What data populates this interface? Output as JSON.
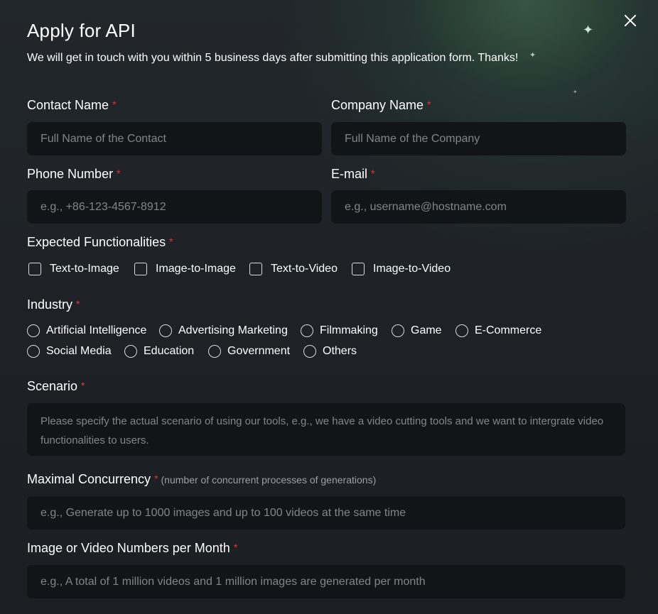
{
  "dialog": {
    "title": "Apply for API",
    "subtitle": "We will get in touch with you within 5 business days after submitting this application form. Thanks!",
    "close_icon": "close-icon"
  },
  "required_mark": "*",
  "fields": {
    "contact_name": {
      "label": "Contact Name",
      "placeholder": "Full Name of the Contact",
      "value": ""
    },
    "company_name": {
      "label": "Company Name",
      "placeholder": "Full Name of the Company",
      "value": ""
    },
    "phone_number": {
      "label": "Phone Number",
      "placeholder": "e.g., +86-123-4567-8912",
      "value": ""
    },
    "email": {
      "label": "E-mail",
      "placeholder": "e.g., username@hostname.com",
      "value": ""
    },
    "scenario": {
      "label": "Scenario",
      "placeholder": "Please specify the actual scenario of using our tools, e.g., we have a video cutting tools and we want to intergrate video functionalities to users.",
      "value": ""
    },
    "concurrency": {
      "label": "Maximal Concurrency",
      "hint": "(number of concurrent processes of generations)",
      "placeholder": "e.g., Generate up to 1000 images and up to 100 videos at the same time",
      "value": ""
    },
    "monthly_numbers": {
      "label": "Image or Video Numbers per Month",
      "placeholder": "e.g., A total of 1 million videos and 1 million images are generated per month",
      "value": ""
    }
  },
  "functionalities": {
    "label": "Expected Functionalities",
    "options": [
      {
        "label": "Text-to-Image",
        "checked": false
      },
      {
        "label": "Image-to-Image",
        "checked": false
      },
      {
        "label": "Text-to-Video",
        "checked": false
      },
      {
        "label": "Image-to-Video",
        "checked": false
      }
    ]
  },
  "industry": {
    "label": "Industry",
    "options": [
      {
        "label": "Artificial Intelligence",
        "selected": false
      },
      {
        "label": "Advertising Marketing",
        "selected": false
      },
      {
        "label": "Filmmaking",
        "selected": false
      },
      {
        "label": "Game",
        "selected": false
      },
      {
        "label": "E-Commerce",
        "selected": false
      },
      {
        "label": "Social Media",
        "selected": false
      },
      {
        "label": "Education",
        "selected": false
      },
      {
        "label": "Government",
        "selected": false
      },
      {
        "label": "Others",
        "selected": false
      }
    ]
  },
  "colors": {
    "background": "#1e2226",
    "input_background": "#121518",
    "required": "#e0363a",
    "placeholder": "#80858a",
    "glow": "#2f5a45"
  }
}
